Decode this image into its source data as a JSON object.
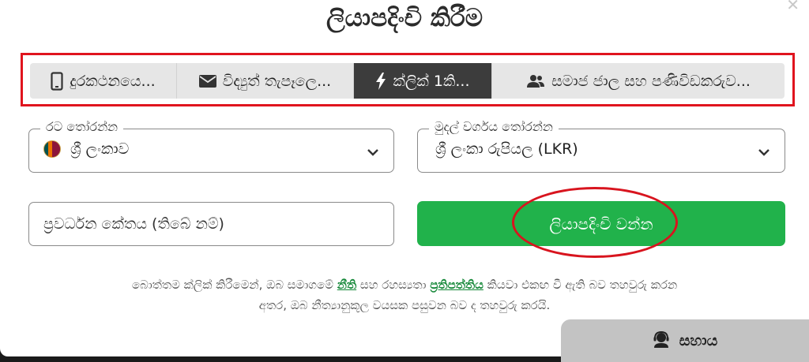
{
  "modal": {
    "title": "ලියාපදිංචි කිරීම",
    "close_icon": "close-icon"
  },
  "tabs": [
    {
      "label": "දුරකථනයෙ...",
      "icon": "phone-icon",
      "active": false
    },
    {
      "label": "විද්‍යුත් තැපෑලෙ...",
      "icon": "envelope-icon",
      "active": false
    },
    {
      "label": "ක්ලික් 1කි...",
      "icon": "lightning-icon",
      "active": true
    },
    {
      "label": "සමාජ ජාල සහ පණිවිඩකරුව...",
      "icon": "users-icon",
      "active": false
    }
  ],
  "country": {
    "legend": "රට තෝරන්න",
    "value": "ශ්‍රී ලංකාව",
    "flag_icon": "sri-lanka-flag-icon"
  },
  "currency": {
    "legend": "මුදල් වර්ගය තෝරන්න",
    "value": "ශ්‍රී ලංකා රුපියල (LKR)"
  },
  "promo": {
    "placeholder": "ප්‍රවර්ධන කේතය (තිබේ නම්)"
  },
  "register_button": {
    "label": "ලියාපදිංචි වන්න"
  },
  "terms": {
    "part1": "බොත්තම ක්ලික් කිරීමෙන්, ඔබ සමාගමේ ",
    "rules_link": "නීති",
    "part2": " සහ රහස්‍යතා ",
    "policy_link": "ප්‍රතිපත්තිය",
    "part3": " කියවා එකඟ වී ඇති බව තහවුරු කරන",
    "line2": "අතර, ඔබ නීත්‍යානුකූල වයසක පසුවන බව ද තහවුරු කරයි."
  },
  "help": {
    "label": "සහාය",
    "icon": "support-agent-icon"
  },
  "colors": {
    "accent_green": "#21b24b",
    "link_green": "#17893a",
    "active_tab": "#3c3c3c",
    "annotation_red": "#e0141e"
  }
}
